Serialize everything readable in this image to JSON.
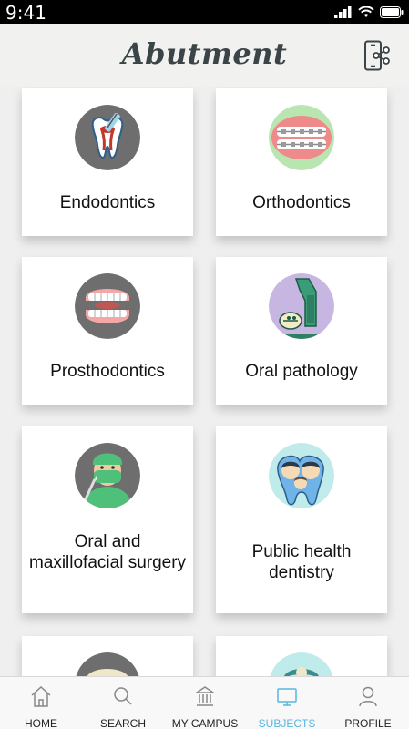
{
  "status": {
    "time": "9:41"
  },
  "header": {
    "title": "Abutment"
  },
  "subjects": [
    {
      "label": "Endodontics"
    },
    {
      "label": "Orthodontics"
    },
    {
      "label": "Prosthodontics"
    },
    {
      "label": "Oral pathology"
    },
    {
      "label": "Oral and maxillofacial surgery"
    },
    {
      "label": "Public health dentistry"
    }
  ],
  "tabs": [
    {
      "label": "HOME",
      "icon": "home-icon"
    },
    {
      "label": "SEARCH",
      "icon": "search-icon"
    },
    {
      "label": "MY CAMPUS",
      "icon": "campus-icon"
    },
    {
      "label": "SUBJECTS",
      "icon": "subjects-icon",
      "active": true
    },
    {
      "label": "PROFILE",
      "icon": "profile-icon"
    }
  ],
  "colors": {
    "accent": "#55b7e0",
    "title": "#3b4447",
    "background": "#efefef"
  }
}
